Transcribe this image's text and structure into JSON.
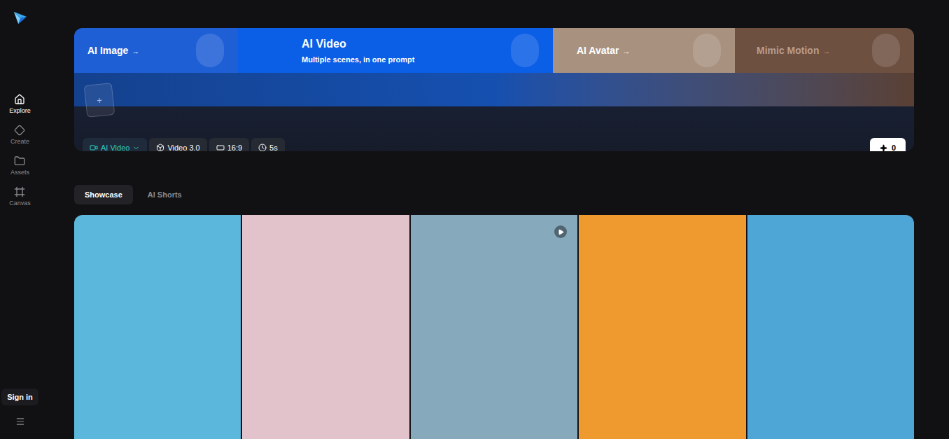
{
  "sidebar": {
    "items": [
      {
        "label": "Explore",
        "selected": true
      },
      {
        "label": "Create",
        "selected": false
      },
      {
        "label": "Assets",
        "selected": false
      },
      {
        "label": "Canvas",
        "selected": false
      }
    ],
    "sign_in": "Sign in"
  },
  "banner": {
    "tabs": [
      {
        "label": "AI Image",
        "arrow": "→",
        "subtitle": "",
        "selected": false,
        "disabled": false,
        "color": "#1f5fd6"
      },
      {
        "label": "AI Video",
        "arrow": "",
        "subtitle": "Multiple scenes, in one prompt",
        "selected": true,
        "disabled": false,
        "color": "#0b5ee6"
      },
      {
        "label": "AI Avatar",
        "arrow": "→",
        "subtitle": "",
        "selected": false,
        "disabled": false,
        "color": "#a8927f"
      },
      {
        "label": "Mimic Motion",
        "arrow": "→",
        "subtitle": "",
        "selected": false,
        "disabled": true,
        "color": "#6e5040"
      }
    ]
  },
  "prompt": {
    "upload": "+"
  },
  "toolbar": {
    "mode": "AI Video",
    "model": "Video 3.0",
    "ratio": "16:9",
    "duration": "5s",
    "credits": "0"
  },
  "tabs": [
    {
      "label": "Showcase",
      "selected": true
    },
    {
      "label": "AI Shorts",
      "selected": false
    }
  ],
  "gallery": [
    {
      "kind": "image",
      "color": "#5bb8dc"
    },
    {
      "kind": "image",
      "color": "#e3c3cb"
    },
    {
      "kind": "video",
      "color": "#86a9bb"
    },
    {
      "kind": "image",
      "color": "#ee9a2e"
    },
    {
      "kind": "image",
      "color": "#4ea6d6"
    }
  ]
}
